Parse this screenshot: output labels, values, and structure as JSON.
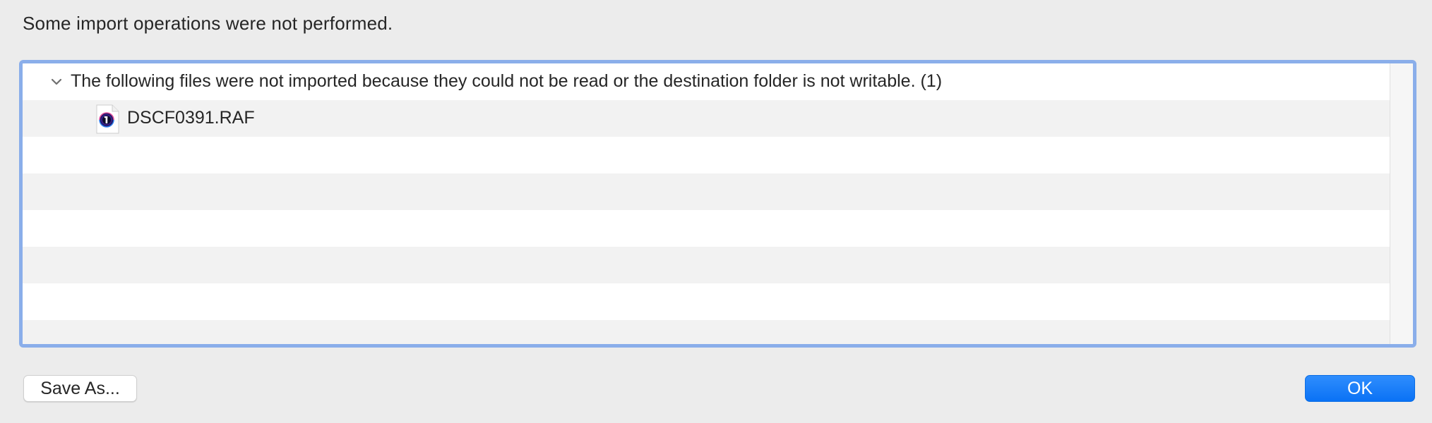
{
  "dialog": {
    "message": "Some import operations were not performed."
  },
  "list": {
    "group": {
      "label": "The following files were not imported because they could not be read or the destination folder is not writable. (1)",
      "expanded": true
    },
    "items": [
      {
        "name": "DSCF0391.RAF",
        "icon": "raw-file-icon"
      }
    ]
  },
  "buttons": {
    "save_label": "Save As...",
    "ok_label": "OK"
  },
  "colors": {
    "focus_ring": "#8aaeea",
    "accent": "#0a72f5",
    "row_alt": "#f2f2f2",
    "background": "#ececec"
  }
}
